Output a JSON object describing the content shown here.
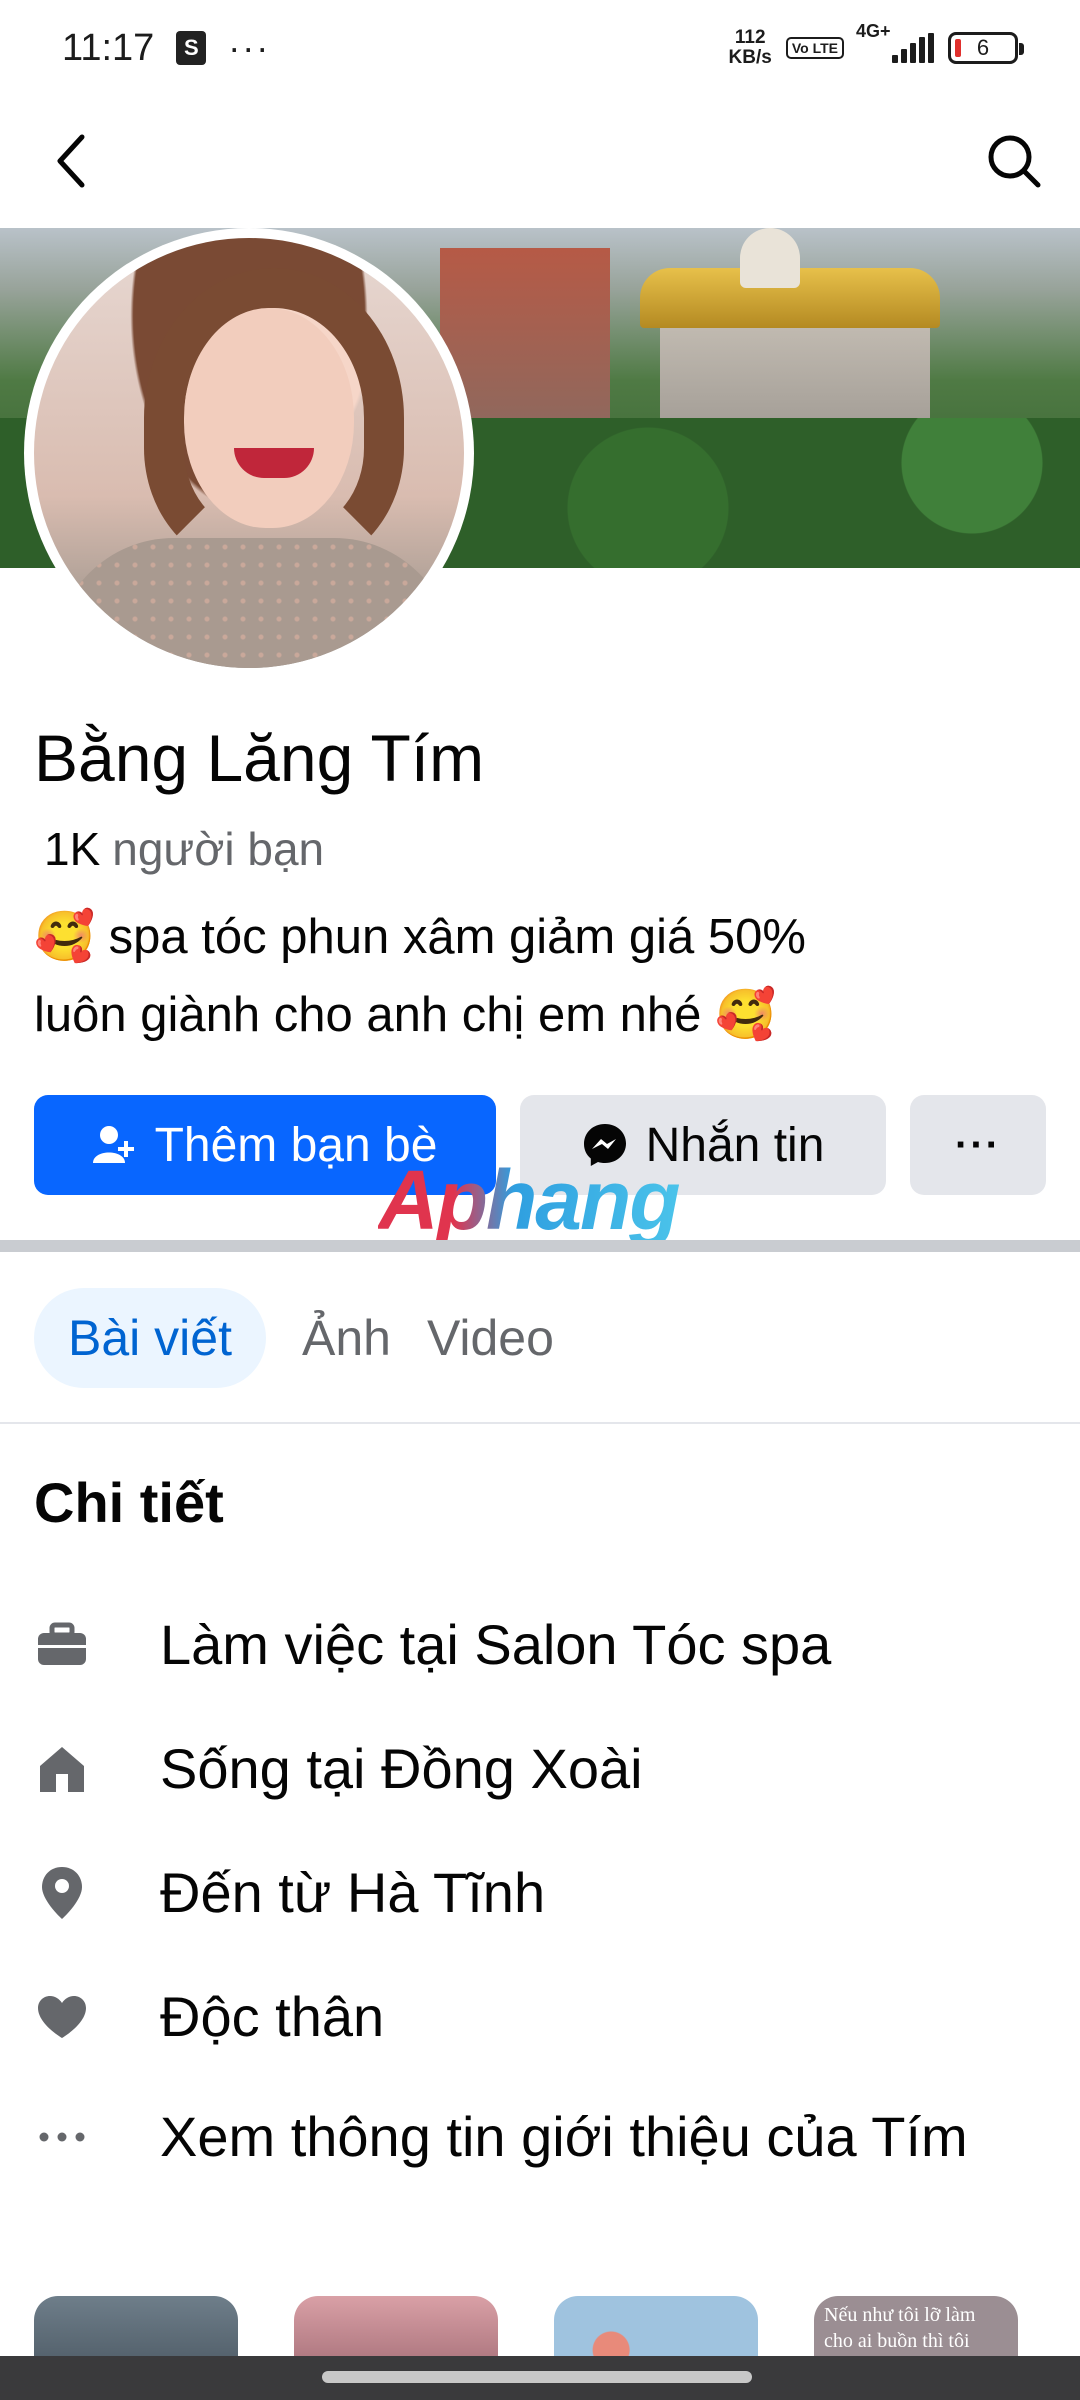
{
  "status_bar": {
    "time": "11:17",
    "shop_icon": "S",
    "more_dots": "···",
    "net_speed_value": "112",
    "net_speed_unit": "KB/s",
    "volte": "Vo LTE",
    "net_type": "4G+",
    "battery": "6"
  },
  "app_bar": {
    "back_icon": "chevron-left-icon",
    "search_icon": "search-icon"
  },
  "profile": {
    "name": "Bằng Lăng Tím",
    "friends_count": "1K",
    "friends_label": "người bạn",
    "bio_line1": "🥰 spa tóc phun xâm giảm giá 50%",
    "bio_line2": "luôn giành cho anh chị em nhé 🥰"
  },
  "actions": {
    "add_friend": "Thêm bạn bè",
    "message": "Nhắn tin",
    "more": "···"
  },
  "watermark": "Aphang",
  "tabs": [
    {
      "label": "Bài viết",
      "active": true
    },
    {
      "label": "Ảnh",
      "active": false
    },
    {
      "label": "Video",
      "active": false
    }
  ],
  "details": {
    "title": "Chi tiết",
    "items": [
      {
        "icon": "briefcase-icon",
        "text": "Làm việc tại Salon Tóc spa"
      },
      {
        "icon": "home-icon",
        "text": "Sống tại Đồng Xoài"
      },
      {
        "icon": "location-pin-icon",
        "text": "Đến từ Hà Tĩnh"
      },
      {
        "icon": "heart-icon",
        "text": "Độc thân"
      },
      {
        "icon": "more-dots-icon",
        "text": "Xem thông tin giới thiệu của Tím"
      }
    ]
  },
  "photos": {
    "thumb4_caption": "Nếu như tôi lỡ làm cho ai buồn thì tôi"
  },
  "colors": {
    "primary": "#0866ff",
    "secondary_button": "#e4e6eb",
    "tab_active_bg": "#ebf5ff",
    "tab_active_text": "#0064d1",
    "muted_text": "#65676b"
  }
}
